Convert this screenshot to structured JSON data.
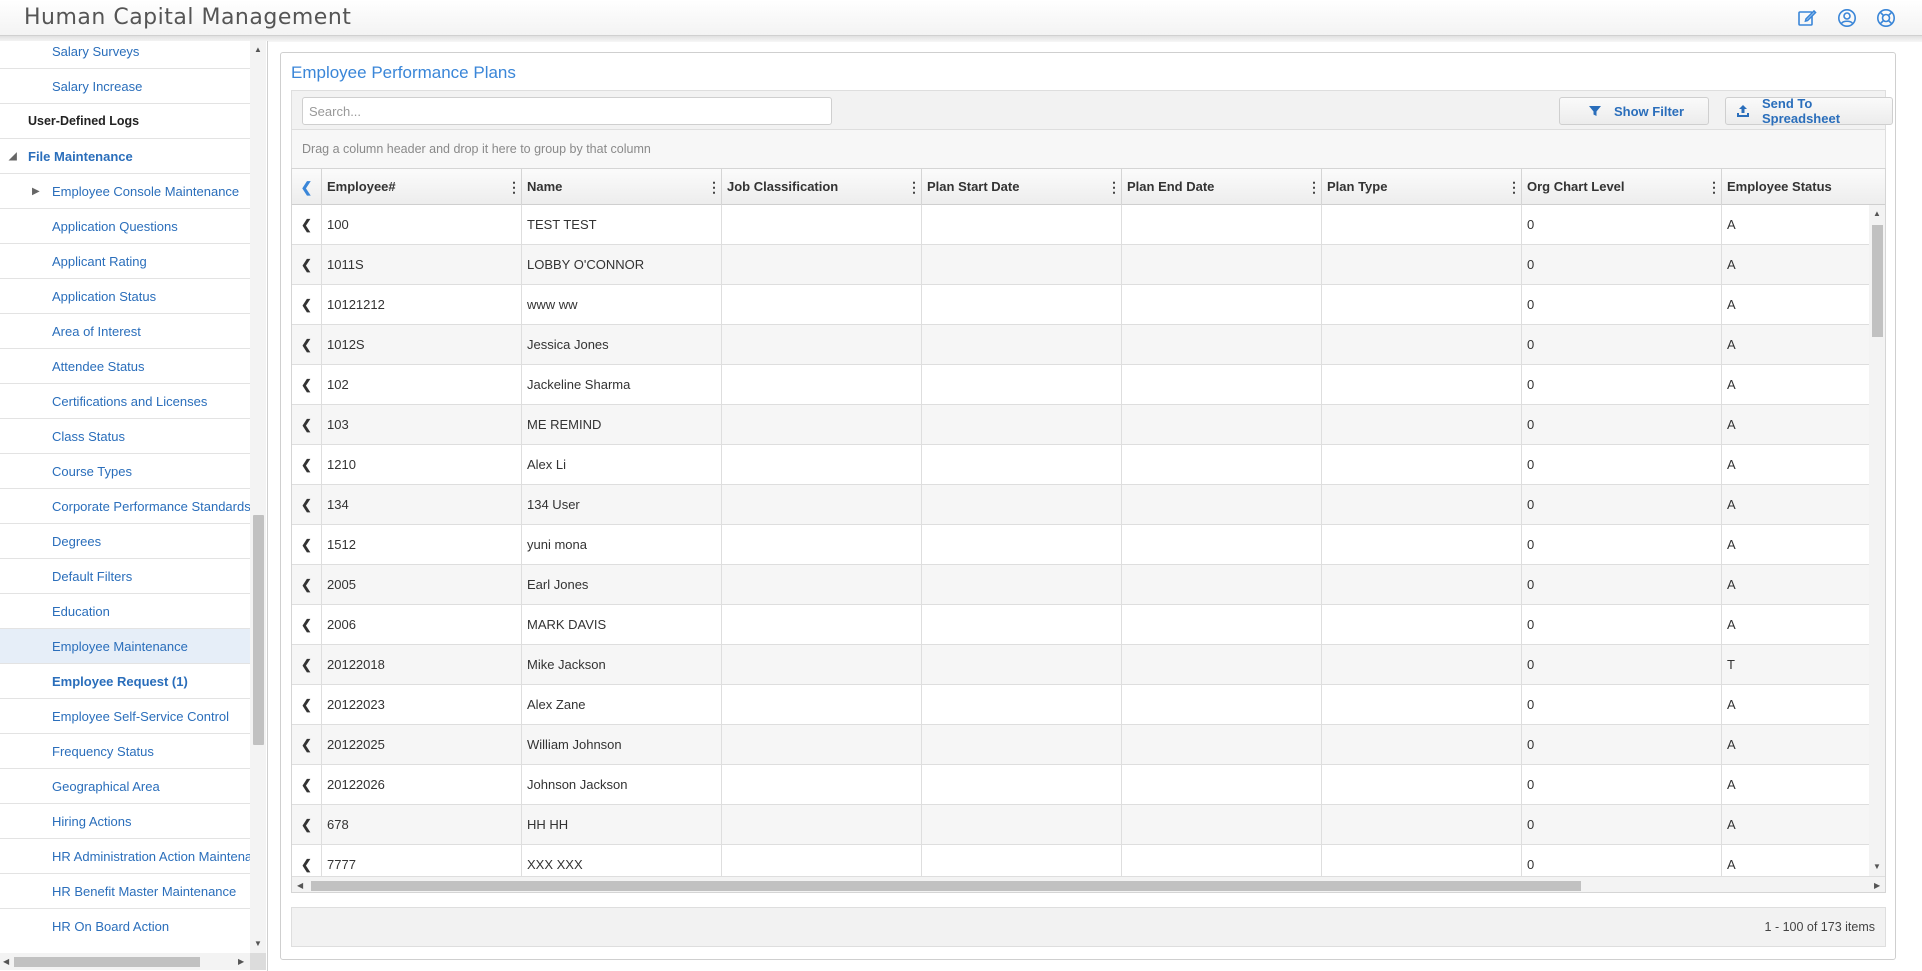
{
  "app": {
    "title": "Human Capital Management"
  },
  "header_icons": [
    "edit-icon",
    "user-icon",
    "help-icon"
  ],
  "sidebar": {
    "items": [
      {
        "label": "Salary Surveys",
        "kind": "child"
      },
      {
        "label": "Salary Increase",
        "kind": "child"
      },
      {
        "label": "User-Defined Logs",
        "kind": "plain"
      },
      {
        "label": "File Maintenance",
        "kind": "section"
      },
      {
        "label": "Employee Console Maintenance",
        "kind": "child"
      },
      {
        "label": "Application Questions",
        "kind": "child"
      },
      {
        "label": "Applicant Rating",
        "kind": "child"
      },
      {
        "label": "Application Status",
        "kind": "child"
      },
      {
        "label": "Area of Interest",
        "kind": "child"
      },
      {
        "label": "Attendee Status",
        "kind": "child"
      },
      {
        "label": "Certifications and Licenses",
        "kind": "child"
      },
      {
        "label": "Class Status",
        "kind": "child"
      },
      {
        "label": "Course Types",
        "kind": "child"
      },
      {
        "label": "Corporate Performance Standards",
        "kind": "child"
      },
      {
        "label": "Degrees",
        "kind": "child"
      },
      {
        "label": "Default Filters",
        "kind": "child"
      },
      {
        "label": "Education",
        "kind": "child"
      },
      {
        "label": "Employee Maintenance",
        "kind": "child"
      },
      {
        "label": "Employee Request (1)",
        "kind": "child"
      },
      {
        "label": "Employee Self-Service Control",
        "kind": "child"
      },
      {
        "label": "Frequency Status",
        "kind": "child"
      },
      {
        "label": "Geographical Area",
        "kind": "child"
      },
      {
        "label": "Hiring Actions",
        "kind": "child"
      },
      {
        "label": "HR Administration Action Maintenance",
        "kind": "child"
      },
      {
        "label": "HR Benefit Master Maintenance",
        "kind": "child"
      },
      {
        "label": "HR On Board Action",
        "kind": "child"
      }
    ],
    "selected": "Employee Maintenance"
  },
  "main": {
    "title": "Employee Performance Plans",
    "search_placeholder": "Search...",
    "show_filter_label": "Show Filter",
    "send_spreadsheet_label": "Send To Spreadsheet",
    "group_hint": "Drag a column header and drop it here to group by that column",
    "columns": [
      "Employee#",
      "Name",
      "Job Classification",
      "Plan Start Date",
      "Plan End Date",
      "Plan Type",
      "Org Chart Level",
      "Employee Status"
    ],
    "rows": [
      [
        "100",
        "TEST TEST",
        "",
        "",
        "",
        "",
        "0",
        "A"
      ],
      [
        "1011S",
        "LOBBY O'CONNOR",
        "",
        "",
        "",
        "",
        "0",
        "A"
      ],
      [
        "10121212",
        "www ww",
        "",
        "",
        "",
        "",
        "0",
        "A"
      ],
      [
        "1012S",
        "Jessica Jones",
        "",
        "",
        "",
        "",
        "0",
        "A"
      ],
      [
        "102",
        "Jackeline Sharma",
        "",
        "",
        "",
        "",
        "0",
        "A"
      ],
      [
        "103",
        "ME REMIND",
        "",
        "",
        "",
        "",
        "0",
        "A"
      ],
      [
        "1210",
        "Alex Li",
        "",
        "",
        "",
        "",
        "0",
        "A"
      ],
      [
        "134",
        "134 User",
        "",
        "",
        "",
        "",
        "0",
        "A"
      ],
      [
        "1512",
        "yuni mona",
        "",
        "",
        "",
        "",
        "0",
        "A"
      ],
      [
        "2005",
        "Earl Jones",
        "",
        "",
        "",
        "",
        "0",
        "A"
      ],
      [
        "2006",
        "MARK DAVIS",
        "",
        "",
        "",
        "",
        "0",
        "A"
      ],
      [
        "20122018",
        "Mike Jackson",
        "",
        "",
        "",
        "",
        "0",
        "T"
      ],
      [
        "20122023",
        "Alex Zane",
        "",
        "",
        "",
        "",
        "0",
        "A"
      ],
      [
        "20122025",
        "William Johnson",
        "",
        "",
        "",
        "",
        "0",
        "A"
      ],
      [
        "20122026",
        "Johnson Jackson",
        "",
        "",
        "",
        "",
        "0",
        "A"
      ],
      [
        "678",
        "HH HH",
        "",
        "",
        "",
        "",
        "0",
        "A"
      ],
      [
        "7777",
        "XXX XXX",
        "",
        "",
        "",
        "",
        "0",
        "A"
      ]
    ],
    "pager_info": "1 - 100 of 173 items"
  }
}
